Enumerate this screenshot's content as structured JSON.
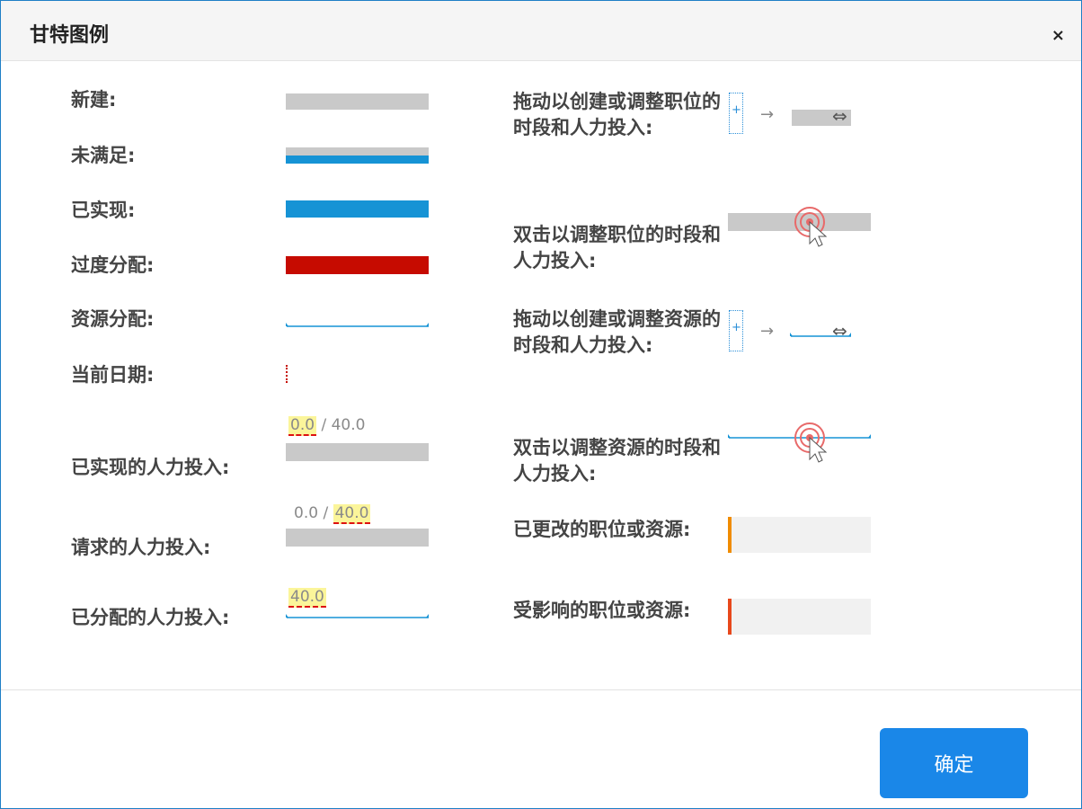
{
  "dialog": {
    "title": "甘特图例",
    "close": "×",
    "ok": "确定"
  },
  "left": {
    "new": "新建:",
    "unfulfilled": "未满足:",
    "realized": "已实现:",
    "overallocated": "过度分配:",
    "resource_alloc": "资源分配:",
    "current_date": "当前日期:",
    "realized_effort": "已实现的人力投入:",
    "requested_effort": "请求的人力投入:",
    "allocated_effort": "已分配的人力投入:"
  },
  "values": {
    "realized_effort_value": "0.0",
    "realized_effort_sep_total": "/ 40.0",
    "requested_effort_value_sep": "0.0 /",
    "requested_effort_total": "40.0",
    "allocated_effort_value": "40.0"
  },
  "right": {
    "drag_position": "拖动以创建或调整职位的时段和人力投入:",
    "dblclick_position": "双击以调整职位的时段和人力投入:",
    "drag_resource": "拖动以创建或调整资源的时段和人力投入:",
    "dblclick_resource": "双击以调整资源的时段和人力投入:",
    "changed": "已更改的职位或资源:",
    "affected": "受影响的职位或资源:"
  },
  "glyphs": {
    "plus": "+",
    "arrow": "→",
    "resize": "⇔"
  },
  "colors": {
    "accent": "#1a87e8",
    "bar_gray": "#c9c9c9",
    "bar_blue": "#1693d5",
    "bar_red": "#c60b00",
    "changed_marker": "#f08c00",
    "affected_marker": "#e8481c"
  }
}
